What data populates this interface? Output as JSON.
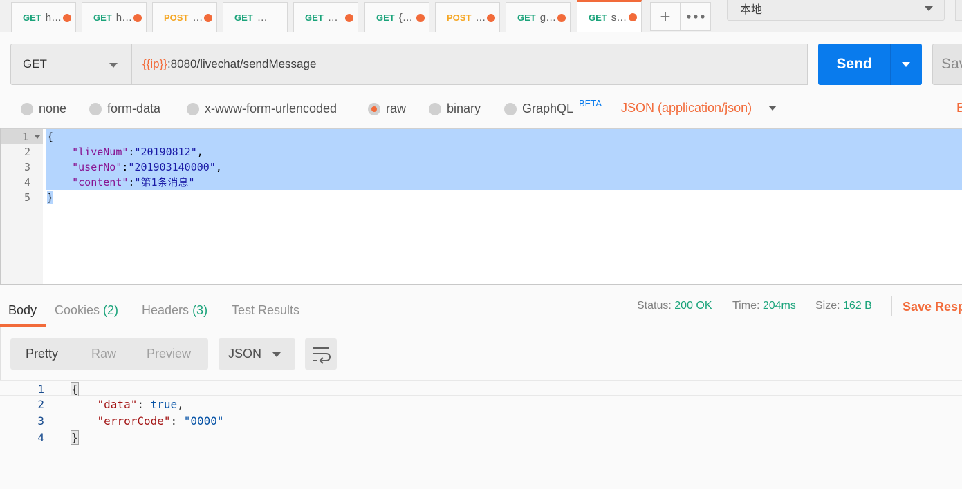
{
  "tabs": [
    {
      "method": "GET",
      "name": "h…",
      "type": "get"
    },
    {
      "method": "GET",
      "name": "h…",
      "type": "get"
    },
    {
      "method": "POST",
      "name": "…",
      "type": "post"
    },
    {
      "method": "GET",
      "name": "…",
      "type": "get"
    },
    {
      "method": "GET",
      "name": "…",
      "type": "get"
    },
    {
      "method": "GET",
      "name": "{…",
      "type": "get"
    },
    {
      "method": "POST",
      "name": "…",
      "type": "post"
    },
    {
      "method": "GET",
      "name": "g…",
      "type": "get"
    },
    {
      "method": "GET",
      "name": "s…",
      "type": "get",
      "active": true
    }
  ],
  "tab_actions": {
    "add_icon": "plus-icon",
    "more_icon": "more-dots-icon"
  },
  "environment": {
    "selected": "本地"
  },
  "request": {
    "method": "GET",
    "url_var": "{{ip}}",
    "url_rest": ":8080/livechat/sendMessage",
    "send_label": "Send",
    "save_label": "Sav"
  },
  "body_types": {
    "options": [
      "none",
      "form-data",
      "x-www-form-urlencoded",
      "raw",
      "binary",
      "GraphQL"
    ],
    "selected": "raw",
    "beta_badge": "BETA",
    "content_type": "JSON (application/json)",
    "edge_text": "B"
  },
  "request_body": {
    "line_numbers": [
      "1",
      "2",
      "3",
      "4",
      "5"
    ],
    "open": "{",
    "close": "}",
    "fields": [
      {
        "key": "\"liveNum\"",
        "value": "\"20190812\"",
        "sep": ","
      },
      {
        "key": "\"userNo\"",
        "value": "\"201903140000\"",
        "sep": ","
      },
      {
        "key": "\"content\"",
        "value": "\"第1条消息\"",
        "sep": ""
      }
    ]
  },
  "response_tabs": {
    "body": "Body",
    "cookies": "Cookies",
    "cookies_count": "(2)",
    "headers": "Headers",
    "headers_count": "(3)",
    "test_results": "Test Results"
  },
  "response_meta": {
    "status_label": "Status:",
    "status_value": "200 OK",
    "time_label": "Time:",
    "time_value": "204ms",
    "size_label": "Size:",
    "size_value": "162 B",
    "save_response": "Save Resp"
  },
  "response_view": {
    "options": [
      "Pretty",
      "Raw",
      "Preview"
    ],
    "selected": "Pretty",
    "format": "JSON",
    "wrap_icon": "wrap-lines-icon"
  },
  "response_body": {
    "line_numbers": [
      "1",
      "2",
      "3",
      "4"
    ],
    "open": "{",
    "close": "}",
    "data_key": "\"data\"",
    "data_value": "true",
    "error_key": "\"errorCode\"",
    "error_value": "\"0000\""
  },
  "colors": {
    "accent": "#f26b3a",
    "send_blue": "#097bed",
    "get_green": "#1aa37a",
    "post_yellow": "#f5a623",
    "selection": "#b4d5fe"
  }
}
